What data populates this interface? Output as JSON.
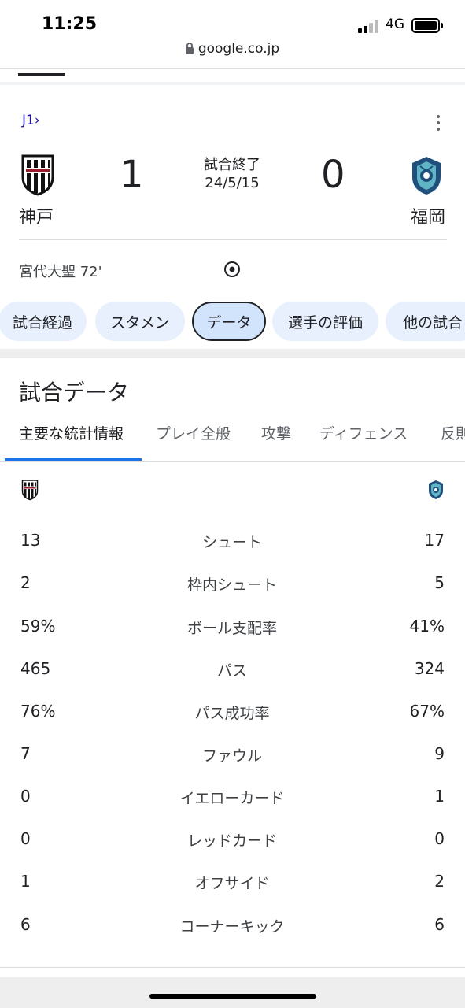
{
  "status_bar": {
    "time": "11:25",
    "network": "4G"
  },
  "browser": {
    "url": "google.co.jp"
  },
  "match": {
    "league": "J1",
    "league_chevron": "›",
    "home": {
      "name": "神戸",
      "score": "1",
      "crest": "vissel-kobe-crest"
    },
    "away": {
      "name": "福岡",
      "score": "0",
      "crest": "avispa-fukuoka-crest"
    },
    "status": "試合終了",
    "date": "24/5/15",
    "scorer": "宮代大聖 72'"
  },
  "chips": [
    {
      "label": "試合経過",
      "active": false
    },
    {
      "label": "スタメン",
      "active": false
    },
    {
      "label": "データ",
      "active": true
    },
    {
      "label": "選手の評価",
      "active": false
    },
    {
      "label": "他の試合",
      "active": false
    }
  ],
  "section_title": "試合データ",
  "subtabs": [
    {
      "label": "主要な統計情報",
      "active": true
    },
    {
      "label": "プレイ全般",
      "active": false
    },
    {
      "label": "攻撃",
      "active": false
    },
    {
      "label": "ディフェンス",
      "active": false
    },
    {
      "label": "反則",
      "active": false
    }
  ],
  "stats": [
    {
      "label": "シュート",
      "home": "13",
      "away": "17"
    },
    {
      "label": "枠内シュート",
      "home": "2",
      "away": "5"
    },
    {
      "label": "ボール支配率",
      "home": "59%",
      "away": "41%"
    },
    {
      "label": "パス",
      "home": "465",
      "away": "324"
    },
    {
      "label": "パス成功率",
      "home": "76%",
      "away": "67%"
    },
    {
      "label": "ファウル",
      "home": "7",
      "away": "9"
    },
    {
      "label": "イエローカード",
      "home": "0",
      "away": "1"
    },
    {
      "label": "レッドカード",
      "home": "0",
      "away": "0"
    },
    {
      "label": "オフサイド",
      "home": "1",
      "away": "2"
    },
    {
      "label": "コーナーキック",
      "home": "6",
      "away": "6"
    }
  ],
  "colors": {
    "chip_bg": "#e8f0fe",
    "chip_active_bg": "#d2e3fc",
    "tab_accent": "#1a73e8",
    "link": "#1a0dab"
  }
}
